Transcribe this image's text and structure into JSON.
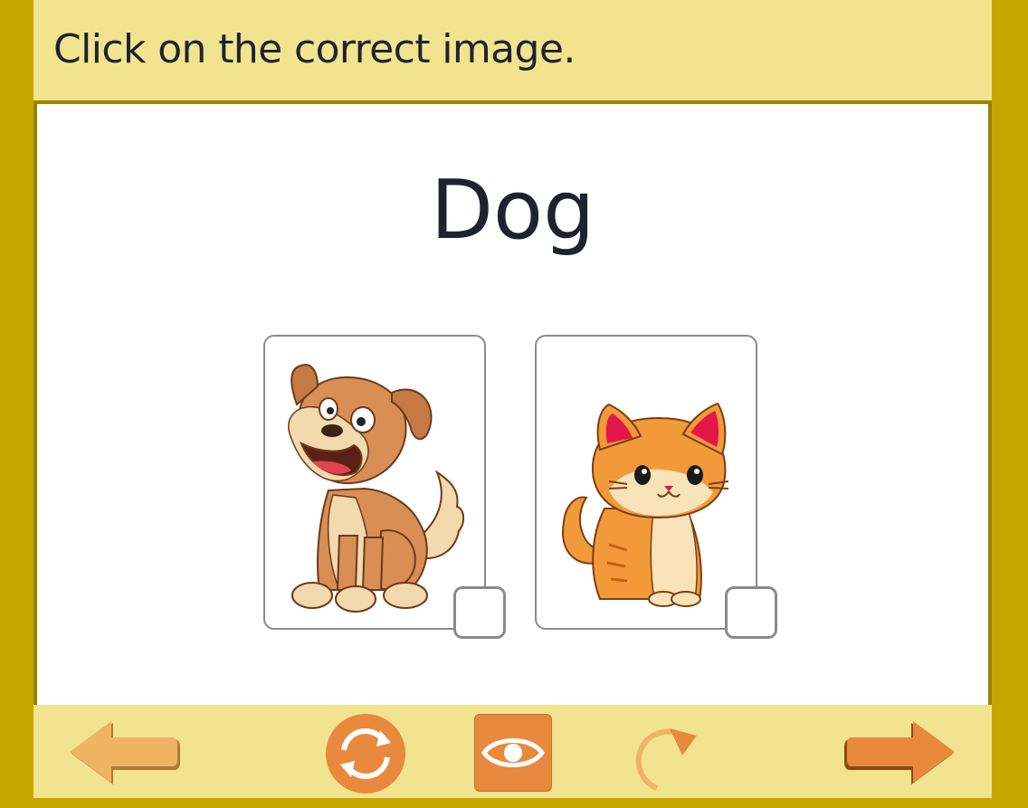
{
  "header": {
    "instruction": "Click on the correct image."
  },
  "question": {
    "word": "Dog"
  },
  "choices": [
    {
      "image": "dog-illustration",
      "checked": false
    },
    {
      "image": "cat-illustration",
      "checked": false
    }
  ],
  "toolbar": {
    "buttons": [
      {
        "icon": "arrow-left-icon"
      },
      {
        "icon": "reset-icon"
      },
      {
        "icon": "eye-icon"
      },
      {
        "icon": "redo-icon"
      },
      {
        "icon": "arrow-right-icon"
      }
    ]
  },
  "colors": {
    "frame": "#c4a800",
    "panel": "#f2e48e",
    "card_border": "#9a8200",
    "accent_orange": "#e8893e",
    "accent_orange_light": "#eeb365",
    "text": "#1f2330"
  }
}
